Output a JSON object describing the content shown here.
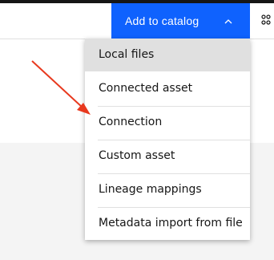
{
  "header": {
    "add_button_label": "Add to catalog",
    "add_button_color": "#0f62fe",
    "chevron_icon": "chevron-up-icon",
    "partial_icon": "grid-icon"
  },
  "menu": {
    "items": [
      {
        "label": "Local files",
        "selected": true
      },
      {
        "label": "Connected asset"
      },
      {
        "label": "Connection"
      },
      {
        "label": "Custom asset"
      },
      {
        "label": "Lineage mappings"
      },
      {
        "label": "Metadata import from file"
      }
    ]
  },
  "annotation": {
    "arrow_color": "#e8391e",
    "points_to": "Connection"
  }
}
